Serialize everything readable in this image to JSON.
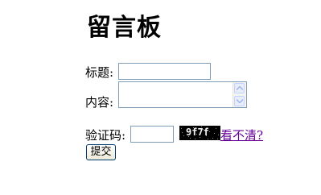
{
  "page": {
    "title": "留言板"
  },
  "form": {
    "title_label": "标题:",
    "title_value": "",
    "content_label": "内容:",
    "content_value": "",
    "captcha_label": "验证码:",
    "captcha_value": "",
    "captcha_image_text": "9f7f",
    "refresh_link": "看不清?",
    "submit_label": "提交"
  },
  "colors": {
    "input_border": "#7f9db9",
    "link": "#660099",
    "captcha_bg": "#000000"
  }
}
